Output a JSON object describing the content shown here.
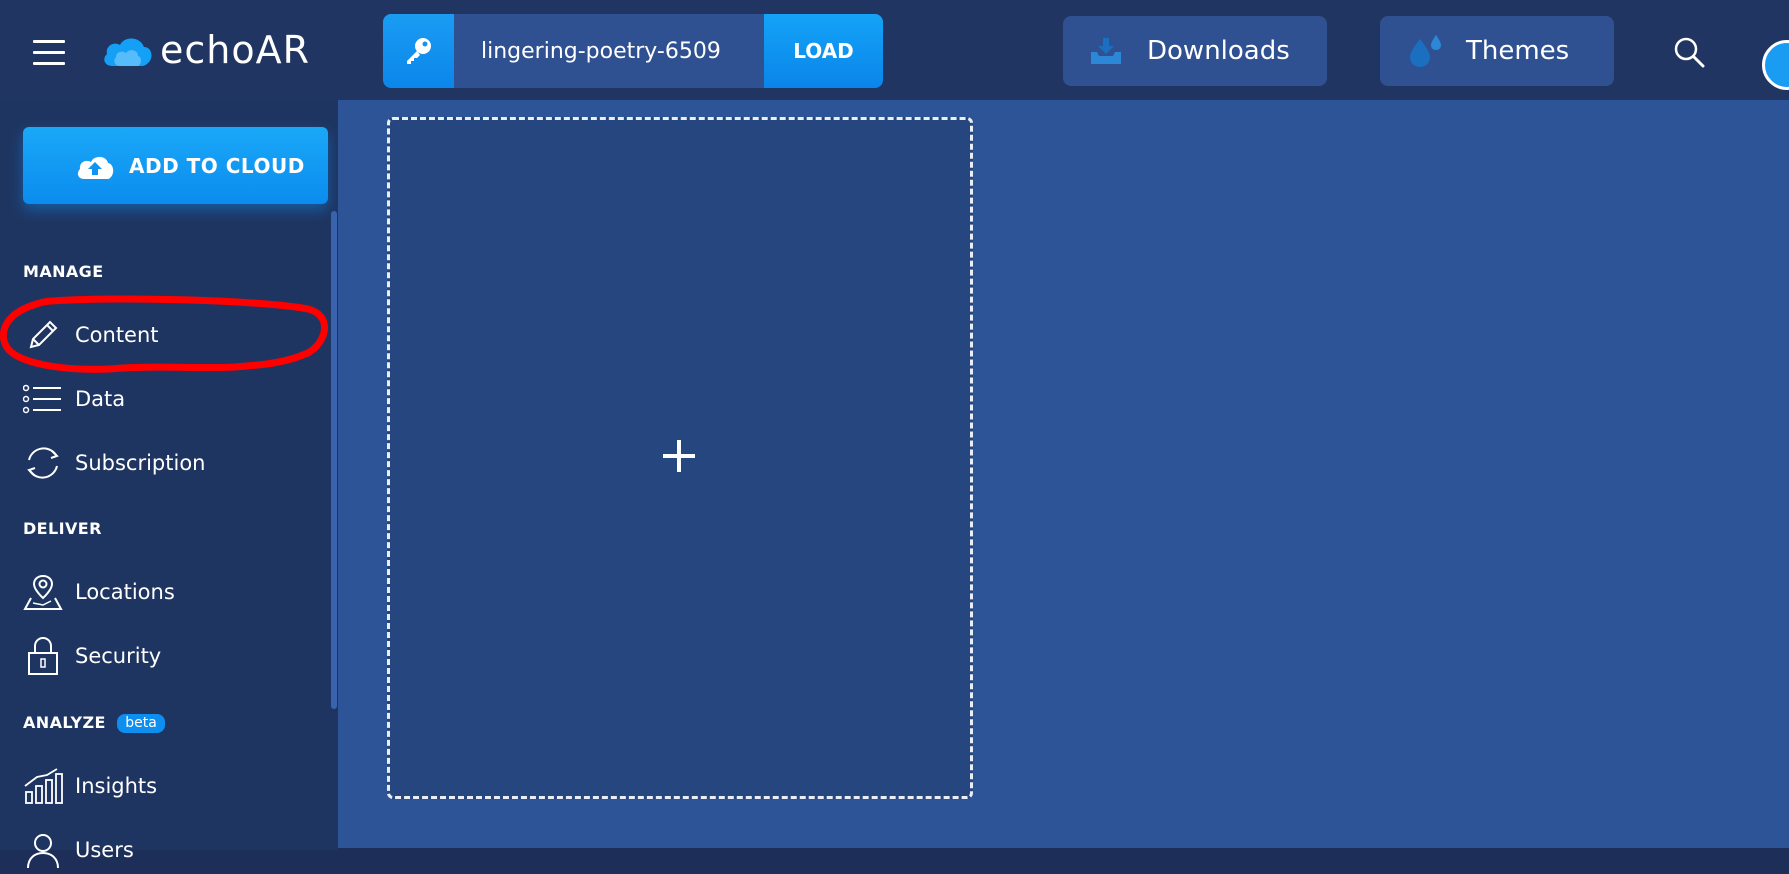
{
  "header": {
    "app_name": "echoAR",
    "api_key": "lingering-poetry-6509",
    "load_label": "LOAD",
    "downloads_label": "Downloads",
    "themes_label": "Themes"
  },
  "sidebar": {
    "add_to_cloud_label": "ADD TO CLOUD",
    "sections": [
      {
        "title": "MANAGE",
        "items": [
          {
            "label": "Content"
          },
          {
            "label": "Data"
          },
          {
            "label": "Subscription"
          }
        ]
      },
      {
        "title": "DELIVER",
        "items": [
          {
            "label": "Locations"
          },
          {
            "label": "Security"
          }
        ]
      },
      {
        "title": "ANALYZE",
        "badge": "beta",
        "items": [
          {
            "label": "Insights"
          },
          {
            "label": "Users"
          }
        ]
      }
    ]
  },
  "main": {
    "dropzone_symbol": "+"
  },
  "icons": {
    "menu": "hamburger-menu-icon",
    "logo": "cloud-logo-icon",
    "key": "key-icon",
    "download": "download-icon",
    "themes": "paint-drops-icon",
    "search": "search-icon",
    "upload": "cloud-upload-icon",
    "content": "pencil-icon",
    "data": "list-icon",
    "subscription": "refresh-icon",
    "locations": "map-pin-icon",
    "security": "lock-icon",
    "insights": "bar-chart-icon",
    "users": "user-icon"
  },
  "colors": {
    "accent": "#0b8cee",
    "topbar": "#203562",
    "sidebar": "#1f3561",
    "main": "#2d5497",
    "annotation": "#ff0000"
  }
}
